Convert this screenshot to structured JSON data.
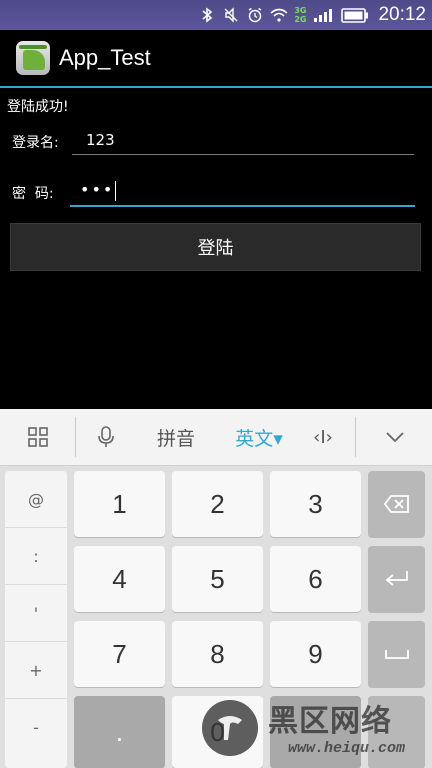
{
  "status_bar": {
    "time": "20:12",
    "network_top": "3G",
    "network_bottom": "2G",
    "icons": [
      "bluetooth-icon",
      "mute-icon",
      "alarm-icon",
      "wifi-icon",
      "signal-icon",
      "battery-icon"
    ]
  },
  "app": {
    "title": "App_Test"
  },
  "form": {
    "success_message": "登陆成功!",
    "username_label": "登录名:",
    "username_value": "123",
    "password_label": "密  码:",
    "password_value": "•••",
    "login_label": "登陆"
  },
  "keyboard": {
    "toolbar": {
      "pinyin": "拼音",
      "english": "英文▾",
      "cursor_tool": "‹I›"
    },
    "side_keys": [
      "@",
      ":",
      "'",
      "+",
      "-"
    ],
    "keys": [
      "1",
      "2",
      "3",
      "4",
      "5",
      "6",
      "7",
      "8",
      "9",
      ".",
      "0"
    ],
    "accent_color": "#33a9cf"
  },
  "watermark": {
    "text": "黑区网络",
    "url": "www.heiqu.com"
  }
}
